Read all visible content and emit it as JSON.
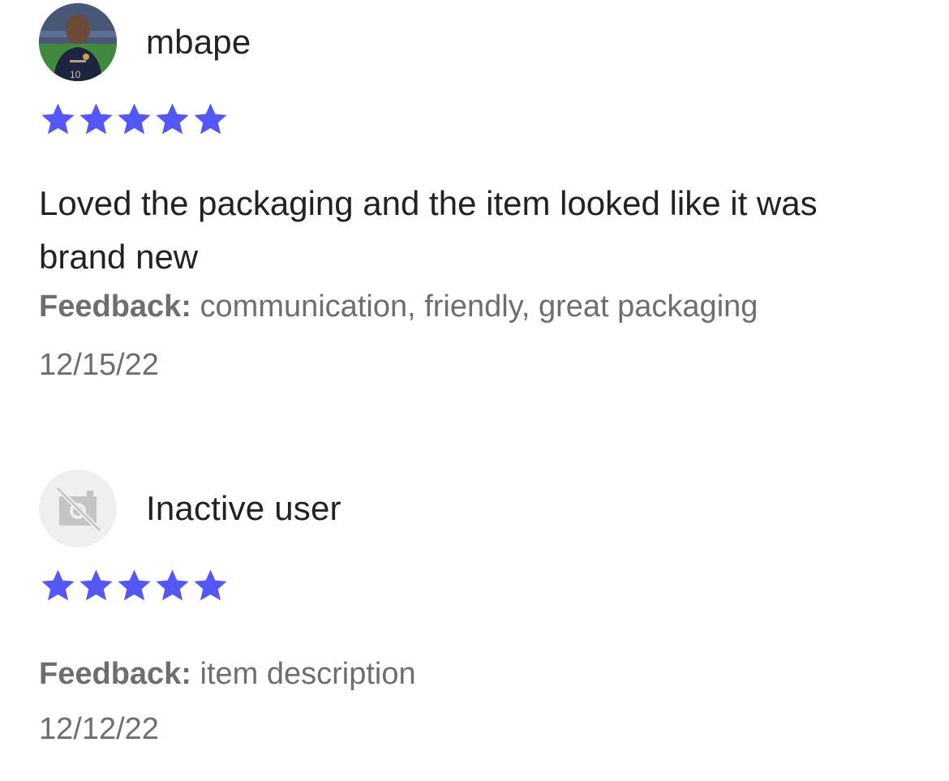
{
  "reviews": [
    {
      "username": "mbape",
      "avatar": "user-photo-avatar",
      "rating": 5,
      "max_rating": 5,
      "text": "Loved the packaging and the item looked like it was brand new",
      "feedback_label": "Feedback:",
      "feedback_value": " communication, friendly, great packaging",
      "date": "12/15/22"
    },
    {
      "username": "Inactive user",
      "avatar": "no-photo-icon",
      "rating": 5,
      "max_rating": 5,
      "text": "",
      "feedback_label": "Feedback:",
      "feedback_value": " item description",
      "date": "12/12/22"
    }
  ],
  "colors": {
    "star": "#5257f5",
    "secondary_text": "#6e6e6e",
    "primary_text": "#222222",
    "inactive_avatar_bg": "#efeff1"
  }
}
